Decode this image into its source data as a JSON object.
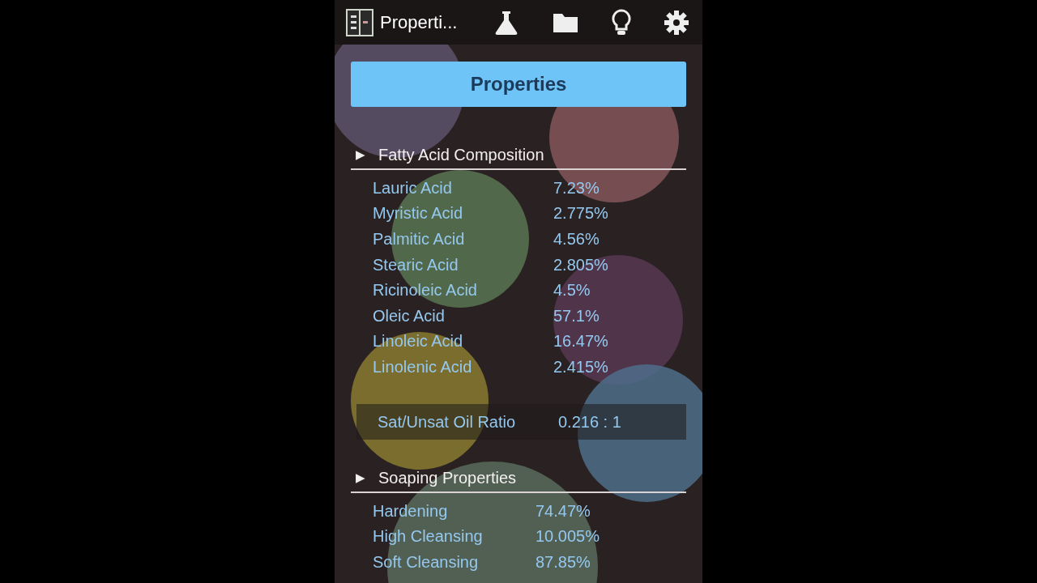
{
  "action_bar": {
    "title": "Properti..."
  },
  "header": {
    "label": "Properties"
  },
  "sections": [
    {
      "marker": "▶",
      "title": "Fatty Acid Composition",
      "rows": [
        {
          "label": "Lauric Acid",
          "value": "7.23%"
        },
        {
          "label": "Myristic Acid",
          "value": "2.775%"
        },
        {
          "label": "Palmitic Acid",
          "value": "4.56%"
        },
        {
          "label": "Stearic Acid",
          "value": "2.805%"
        },
        {
          "label": "Ricinoleic Acid",
          "value": "4.5%"
        },
        {
          "label": "Oleic Acid",
          "value": "57.1%"
        },
        {
          "label": "Linoleic Acid",
          "value": "16.47%"
        },
        {
          "label": "Linolenic Acid",
          "value": "2.415%"
        }
      ],
      "summary": {
        "label": "Sat/Unsat Oil Ratio",
        "value": "0.216 : 1"
      }
    },
    {
      "marker": "▶",
      "title": "Soaping Properties",
      "rows": [
        {
          "label": "Hardening",
          "value": "74.47%"
        },
        {
          "label": "High Cleansing",
          "value": "10.005%"
        },
        {
          "label": "Soft Cleansing",
          "value": "87.85%"
        }
      ]
    }
  ]
}
